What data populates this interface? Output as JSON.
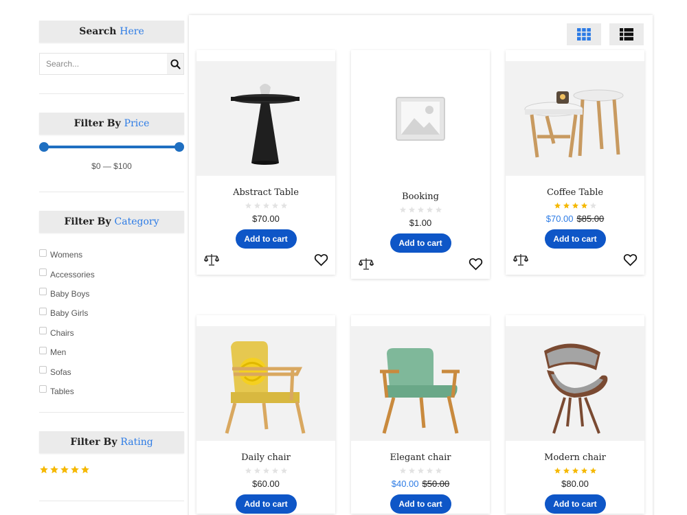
{
  "search": {
    "title_main": "Search",
    "title_accent": "Here",
    "placeholder": "Search..."
  },
  "price_filter": {
    "title_main": "Filter By",
    "title_accent": "Price",
    "range_text": "$0 — $100",
    "min_fraction": 0,
    "max_fraction": 1
  },
  "category_filter": {
    "title_main": "Filter By",
    "title_accent": "Category",
    "items": [
      {
        "label": "Womens"
      },
      {
        "label": "Accessories"
      },
      {
        "label": "Baby Boys"
      },
      {
        "label": "Baby Girls"
      },
      {
        "label": "Chairs"
      },
      {
        "label": "Men"
      },
      {
        "label": "Sofas"
      },
      {
        "label": "Tables"
      }
    ]
  },
  "rating_filter": {
    "title_main": "Filter By",
    "title_accent": "Rating",
    "stars": 5
  },
  "view_toggle": {
    "grid_icon": "grid-icon",
    "list_icon": "list-icon"
  },
  "products": [
    {
      "name": "Abstract Table",
      "rating": 0,
      "price": "$70.00",
      "old_price": "",
      "button": "Add to cart",
      "image": "table-black"
    },
    {
      "name": "Booking",
      "rating": 0,
      "price": "$1.00",
      "old_price": "",
      "button": "Add to cart",
      "image": "placeholder"
    },
    {
      "name": "Coffee Table",
      "rating": 4,
      "price": "$70.00",
      "old_price": "$85.00",
      "button": "Add to cart",
      "image": "coffee-tables"
    },
    {
      "name": "Daily chair",
      "rating": 0,
      "price": "$60.00",
      "old_price": "",
      "button": "Add to cart",
      "image": "yellow-chair"
    },
    {
      "name": "Elegant chair",
      "rating": 0,
      "price": "$40.00",
      "old_price": "$50.00",
      "button": "Add to cart",
      "image": "green-chair"
    },
    {
      "name": "Modern chair",
      "rating": 5,
      "price": "$80.00",
      "old_price": "",
      "button": "Add to cart",
      "image": "grey-chair"
    }
  ],
  "colors": {
    "accent": "#2c7be5",
    "button": "#0e56c7",
    "slider": "#1f6fc1",
    "star": "#f5b800",
    "star_empty": "#e3e3e3"
  }
}
